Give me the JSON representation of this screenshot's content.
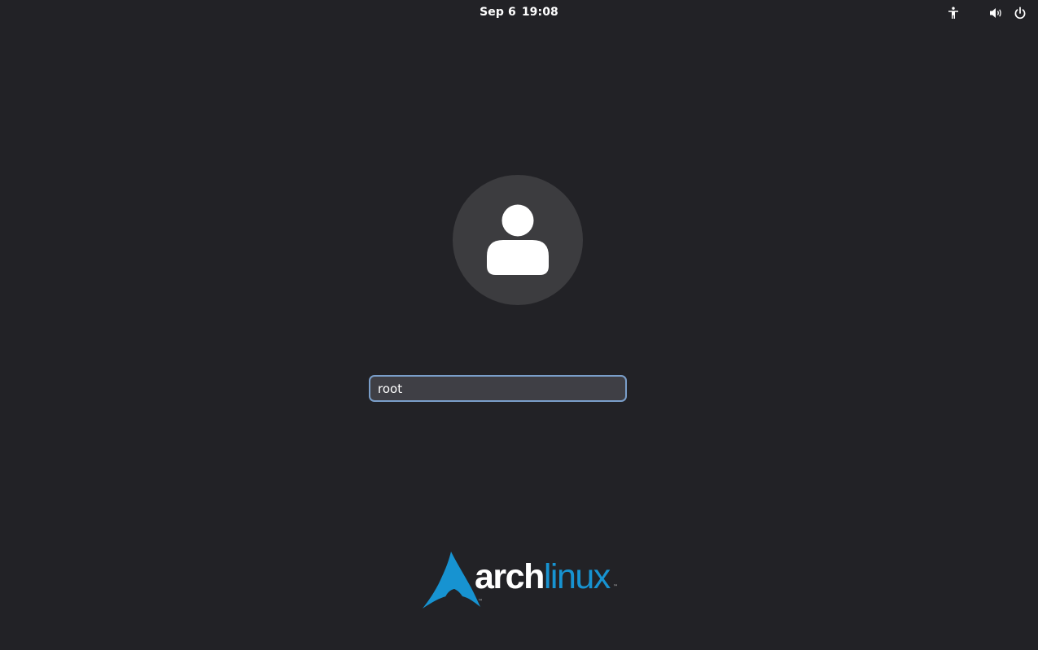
{
  "topbar": {
    "date": "Sep 6",
    "time": "19:08",
    "icons": {
      "accessibility": "accessibility-icon",
      "volume": "volume-icon",
      "power": "power-icon"
    }
  },
  "login": {
    "avatar_icon": "user-avatar-icon",
    "username_value": "root"
  },
  "branding": {
    "logo_word_1": "arch",
    "logo_word_2": "linux",
    "trademark": "™",
    "accent_color": "#1793d1"
  },
  "colors": {
    "background": "#222226",
    "avatar_bg": "#3c3c3f",
    "input_bg": "#3f3f45",
    "input_border": "#7a9ec9"
  }
}
